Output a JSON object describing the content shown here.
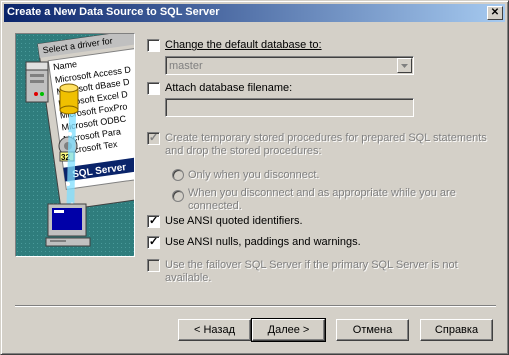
{
  "window": {
    "title": "Create a New Data Source to SQL Server",
    "close_glyph": "✕"
  },
  "illustration": {
    "header": "Select a driver for",
    "column": "Name",
    "drivers": [
      "Microsoft Access D",
      "Microsoft dBase D",
      "Microsoft Excel D",
      "Microsoft FoxPro",
      "Microsoft ODBC",
      "Microsoft Para",
      "Microsoft Tex"
    ],
    "selected": "SQL Server",
    "badge": "32"
  },
  "options": {
    "change_db": {
      "label": "Change the default database to:",
      "checked": false
    },
    "db_combo": {
      "value": "master"
    },
    "attach_db": {
      "label": "Attach database filename:",
      "checked": false
    },
    "temp_procs": {
      "line1": "Create temporary stored procedures for prepared SQL statements",
      "line2": "and drop the stored procedures:",
      "checked": true,
      "enabled": false
    },
    "radio_disconnect": {
      "label": "Only when you disconnect."
    },
    "radio_appropriate": {
      "line1": "When you disconnect and as appropriate while you are",
      "line2": "connected."
    },
    "ansi_quoted": {
      "label": "Use ANSI quoted identifiers.",
      "checked": true
    },
    "ansi_nulls": {
      "label": "Use ANSI nulls, paddings and warnings.",
      "checked": true
    },
    "failover": {
      "line1": "Use the failover SQL Server if the primary SQL Server is not",
      "line2": "available.",
      "checked": false,
      "enabled": false
    }
  },
  "buttons": {
    "back": "< Назад",
    "next": "Далее >",
    "cancel": "Отмена",
    "help": "Справка"
  },
  "icons": [
    "close-icon",
    "server-icon",
    "database-icon",
    "computer-icon",
    "dropdown-arrow-icon",
    "checkmark-icon"
  ]
}
